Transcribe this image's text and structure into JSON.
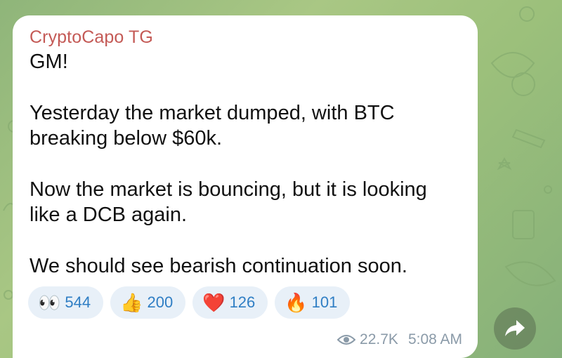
{
  "message": {
    "sender": "CryptoCapo TG",
    "lines": [
      "GM!",
      "",
      "Yesterday the market dumped, with BTC",
      "breaking below $60k.",
      "",
      "Now the market is bouncing, but it is looking",
      "like a DCB again.",
      "",
      "We should see bearish continuation soon."
    ],
    "reactions": [
      {
        "emoji": "👀",
        "icon": "eyes-emoji-icon",
        "count": "544"
      },
      {
        "emoji": "👍",
        "icon": "thumbs-up-emoji-icon",
        "count": "200"
      },
      {
        "emoji": "❤️",
        "icon": "red-heart-emoji-icon",
        "count": "126"
      },
      {
        "emoji": "🔥",
        "icon": "fire-emoji-icon",
        "count": "101"
      }
    ],
    "views": "22.7K",
    "time": "5:08 AM"
  },
  "colors": {
    "sender": "#c45a56",
    "reaction_count": "#2f7ec4",
    "reaction_bg": "#e8f0f8",
    "meta": "#8a9aa8"
  }
}
